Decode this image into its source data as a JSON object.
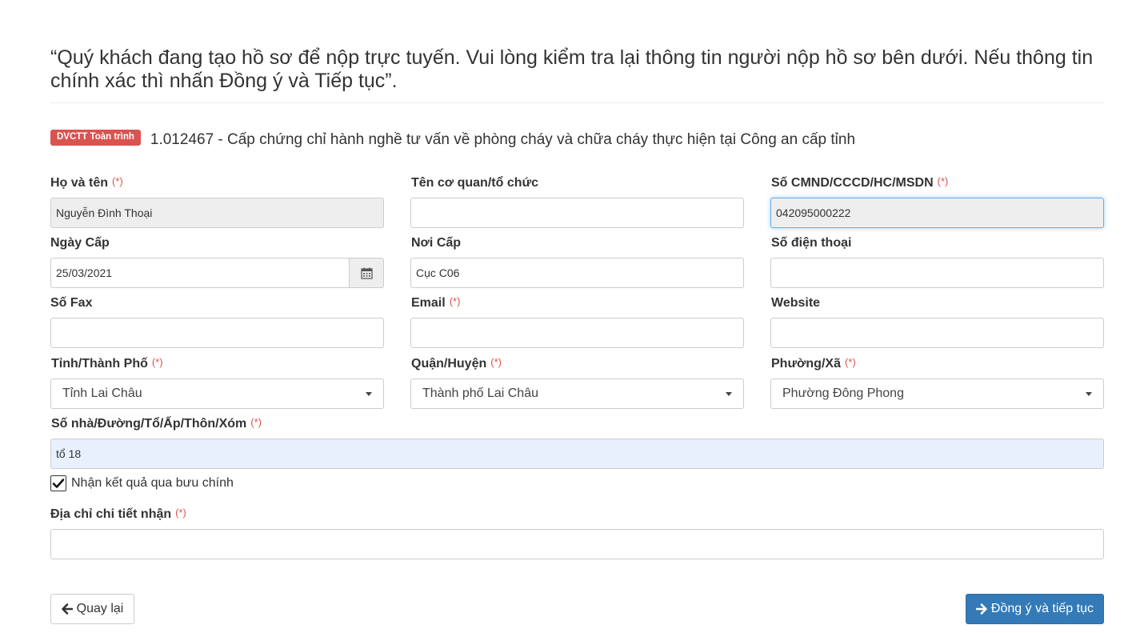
{
  "notice": "“Quý khách đang tạo hồ sơ để nộp trực tuyến. Vui lòng kiểm tra lại thông tin người nộp hồ sơ bên dưới. Nếu thông tin chính xác thì nhấn Đồng ý và Tiếp tục”.",
  "service": {
    "badge": "DVCTT Toàn trình",
    "title": "1.012467 - Cấp chứng chỉ hành nghề tư vấn về phòng cháy và chữa cháy thực hiện tại Công an cấp tỉnh"
  },
  "required_mark": "(*)",
  "fields": {
    "ho_ten": {
      "label": "Họ và tên",
      "value": "Nguyễn Đình Thoại"
    },
    "co_quan": {
      "label": "Tên cơ quan/tổ chức",
      "value": ""
    },
    "cmnd": {
      "label": "Số CMND/CCCD/HC/MSDN",
      "value": "042095000222"
    },
    "ngay_cap": {
      "label": "Ngày Cấp",
      "value": "25/03/2021"
    },
    "noi_cap": {
      "label": "Nơi Cấp",
      "value": "Cục C06"
    },
    "dien_thoai": {
      "label": "Số điện thoại",
      "value": ""
    },
    "fax": {
      "label": "Số Fax",
      "value": ""
    },
    "email": {
      "label": "Email",
      "value": ""
    },
    "website": {
      "label": "Website",
      "value": ""
    },
    "tinh": {
      "label": "Tỉnh/Thành Phố",
      "value": "Tỉnh Lai Châu"
    },
    "quan": {
      "label": "Quận/Huyện",
      "value": "Thành phố Lai Châu"
    },
    "phuong": {
      "label": "Phường/Xã",
      "value": "Phường Đông Phong"
    },
    "so_nha": {
      "label": "Số nhà/Đường/Tổ/Ấp/Thôn/Xóm",
      "value": "tổ 18"
    },
    "dia_chi_nhan": {
      "label": "Địa chỉ chi tiết nhận",
      "value": ""
    }
  },
  "postal": {
    "label": "Nhận kết quả qua bưu chính",
    "checked": true
  },
  "buttons": {
    "back": "Quay lại",
    "agree": "Đồng ý và tiếp tục"
  },
  "icons": {
    "calendar": "calendar-icon",
    "checkmark": "check-icon",
    "back": "arrow-left-icon",
    "agree": "arrow-right-icon"
  },
  "colors": {
    "primary": "#337ab7",
    "badge": "#d9534f",
    "required": "#d9534f"
  }
}
